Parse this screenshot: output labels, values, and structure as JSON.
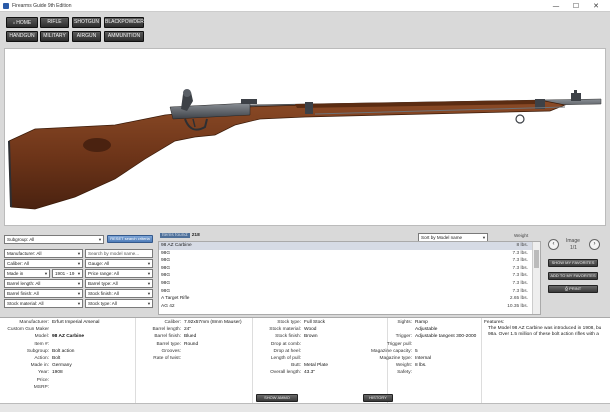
{
  "window": {
    "title": "Firearms Guide 9th Edition",
    "min": "—",
    "max": "☐",
    "close": "✕"
  },
  "nav": {
    "row1": [
      "HOME",
      "RIFLE",
      "SHOTGUN",
      "BLACKPOWDER"
    ],
    "row2": [
      "HANDGUN",
      "MILITARY",
      "AIRGUN",
      "AMMUNITION"
    ]
  },
  "filters": {
    "subgroup": "Subgroup: All",
    "reset": "RESET search criteria",
    "manufacturer": "Manufacturer: All",
    "search_placeholder": "Search by model name...",
    "caliber": "Caliber: All",
    "gauge": "Gauge: All",
    "made_in": "Made in",
    "year_range": "1901 - 19",
    "price_range": "Price range: All",
    "barrel_length": "Barrel length: All",
    "barrel_type": "Barrel type: All",
    "barrel_finish": "Barrel finish: All",
    "stock_finish": "Stock finish: All",
    "stock_material": "Stock material: All",
    "stock_type": "Stock type: All"
  },
  "list": {
    "found_label": "Items found:",
    "found_count": "218",
    "sort": "Sort by Model name",
    "weight_header": "Weight",
    "items": [
      {
        "name": "98 AZ Carbine",
        "weight": "8 lbs."
      },
      {
        "name": "98G",
        "weight": "7.3 lbs."
      },
      {
        "name": "98G",
        "weight": "7.3 lbs."
      },
      {
        "name": "98G",
        "weight": "7.3 lbs."
      },
      {
        "name": "98G",
        "weight": "7.3 lbs."
      },
      {
        "name": "98G",
        "weight": "7.3 lbs."
      },
      {
        "name": "98G",
        "weight": "7.3 lbs."
      },
      {
        "name": "A Target Rifle",
        "weight": "2.65 lbs."
      },
      {
        "name": "AG 42",
        "weight": "10.35 lbs."
      }
    ]
  },
  "image_nav": {
    "label": "Image",
    "counter": "1/1",
    "prev": "‹",
    "next": "›"
  },
  "actions": {
    "show_favorites": "SHOW MY FAVORITES",
    "add_favorites": "ADD TO MY FAVORITES",
    "print": "PRINT"
  },
  "details": {
    "col1": [
      {
        "k": "Manufacturer:",
        "v": "Erfurt Imperial Arsenal"
      },
      {
        "k": "Custom Gun Maker",
        "v": ""
      },
      {
        "k": "Model:",
        "v": "98 AZ Carbine"
      },
      {
        "k": "Item #:",
        "v": ""
      },
      {
        "k": "Subgroup:",
        "v": "Bolt action"
      },
      {
        "k": "Action:",
        "v": "Bolt"
      },
      {
        "k": "Made in:",
        "v": "Germany"
      },
      {
        "k": "Year:",
        "v": "1908"
      },
      {
        "k": "Price:",
        "v": ""
      },
      {
        "k": "MSRP:",
        "v": ""
      }
    ],
    "col2": [
      {
        "k": "Caliber:",
        "v": "7.92x57mm (8mm Mauser)"
      },
      {
        "k": "Barrel length:",
        "v": "24\""
      },
      {
        "k": "Barrel finish:",
        "v": "Blued"
      },
      {
        "k": "Barrel type:",
        "v": "Round"
      },
      {
        "k": "Grooves:",
        "v": ""
      },
      {
        "k": "Rate of twist:",
        "v": ""
      }
    ],
    "col3": [
      {
        "k": "Stock type:",
        "v": "Full Stock"
      },
      {
        "k": "Stock material:",
        "v": "Wood"
      },
      {
        "k": "Stock finish:",
        "v": "Brown"
      },
      {
        "k": "Drop at comb:",
        "v": ""
      },
      {
        "k": "Drop at heel:",
        "v": ""
      },
      {
        "k": "Length of pull:",
        "v": ""
      },
      {
        "k": "Butt:",
        "v": "Metal Plate"
      },
      {
        "k": "Overall length:",
        "v": "43.3\""
      }
    ],
    "col4": [
      {
        "k": "Sights:",
        "v": "Ramp"
      },
      {
        "k": "",
        "v": "Adjustable"
      },
      {
        "k": "Trigger:",
        "v": "Adjustable tangent 300-2000"
      },
      {
        "k": "Trigger pull:",
        "v": ""
      },
      {
        "k": "Magazine capacity:",
        "v": "5"
      },
      {
        "k": "Magazine type:",
        "v": "Internal"
      },
      {
        "k": "Weight:",
        "v": "8 lbs."
      },
      {
        "k": "Safety:",
        "v": ""
      }
    ],
    "features_label": "Features:",
    "features_text_1": "The Model 98 AZ Carbine was introduced in 1908, bu",
    "features_text_2": "98a. Over 1.5 million of these bolt action rifles with a",
    "show_ammo": "SHOW AMMO",
    "history": "HISTORY"
  }
}
